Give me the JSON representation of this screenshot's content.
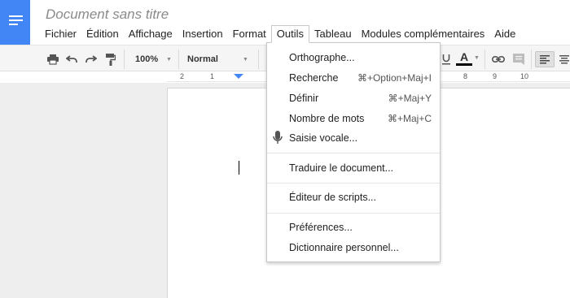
{
  "app": {
    "title": "Document sans titre"
  },
  "menubar": {
    "items": [
      "Fichier",
      "Édition",
      "Affichage",
      "Insertion",
      "Format",
      "Outils",
      "Tableau",
      "Modules complémentaires",
      "Aide"
    ],
    "active": "Outils"
  },
  "toolbar": {
    "zoom": "100%",
    "style": "Normal",
    "text_color_label": "A"
  },
  "ruler": {
    "labels": [
      "2",
      "1",
      "8",
      "9",
      "10"
    ]
  },
  "tools_menu": {
    "items": [
      {
        "label": "Orthographe...",
        "shortcut": ""
      },
      {
        "label": "Recherche",
        "shortcut": "⌘+Option+Maj+I"
      },
      {
        "label": "Définir",
        "shortcut": "⌘+Maj+Y"
      },
      {
        "label": "Nombre de mots",
        "shortcut": "⌘+Maj+C"
      },
      {
        "label": "Saisie vocale...",
        "shortcut": "",
        "icon": "microphone-icon"
      },
      {
        "label": "Traduire le document...",
        "shortcut": ""
      },
      {
        "label": "Éditeur de scripts...",
        "shortcut": ""
      },
      {
        "label": "Préférences...",
        "shortcut": ""
      },
      {
        "label": "Dictionnaire personnel...",
        "shortcut": ""
      }
    ]
  },
  "colors": {
    "brand": "#4285f4",
    "text_color_bar": "#000000"
  }
}
